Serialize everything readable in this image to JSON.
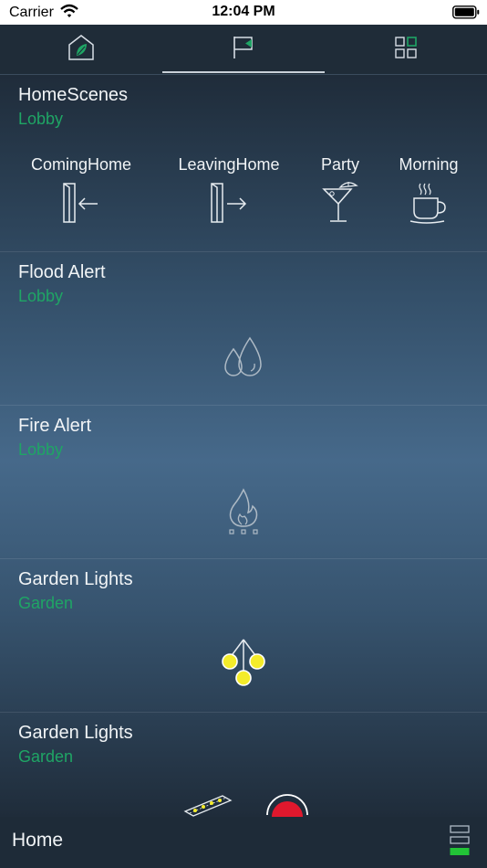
{
  "status": {
    "carrier": "Carrier",
    "time": "12:04 PM"
  },
  "tabs": [
    {
      "icon": "home-leaf-icon",
      "active": false
    },
    {
      "icon": "flag-icon",
      "active": true
    },
    {
      "icon": "grid-icon",
      "active": false
    }
  ],
  "cards": [
    {
      "title": "HomeScenes",
      "location": "Lobby",
      "scenes": [
        {
          "label": "ComingHome",
          "icon": "coming-home-door-icon"
        },
        {
          "label": "LeavingHome",
          "icon": "leaving-home-door-icon"
        },
        {
          "label": "Party",
          "icon": "cocktail-glass-icon"
        },
        {
          "label": "Morning",
          "icon": "coffee-cup-icon"
        }
      ]
    },
    {
      "title": "Flood Alert",
      "location": "Lobby",
      "icon": "water-drops-icon"
    },
    {
      "title": "Fire Alert",
      "location": "Lobby",
      "icon": "flame-icon"
    },
    {
      "title": "Garden Lights",
      "location": "Garden",
      "icon": "garden-lamp-icon"
    },
    {
      "title": "Garden Lights",
      "location": "Garden",
      "icons": [
        "led-strip-icon",
        "red-dome-light-icon"
      ]
    }
  ],
  "bottom": {
    "title": "Home",
    "handle_icon": "level-bars-icon"
  },
  "colors": {
    "accent": "#1fa565",
    "background": "#1e2b38",
    "alert_red": "#e0182d",
    "lamp_yellow": "#f4ec2a"
  }
}
